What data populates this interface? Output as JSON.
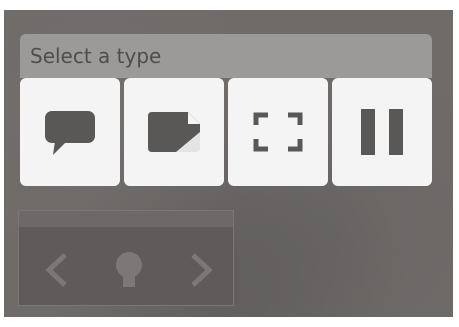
{
  "type_selector": {
    "title": "Select a type",
    "options": [
      {
        "icon": "speech-bubble-icon"
      },
      {
        "icon": "folded-note-icon"
      },
      {
        "icon": "fullscreen-brackets-icon"
      },
      {
        "icon": "pause-icon"
      }
    ]
  },
  "nav": {
    "prev_icon": "chevron-left-icon",
    "center_icon": "home-icon",
    "next_icon": "chevron-right-icon"
  },
  "colors": {
    "icon": "#5a5757",
    "header_bg": "#9c9a98",
    "button_bg": "#f4f4f4",
    "background": "#6f6b69"
  }
}
